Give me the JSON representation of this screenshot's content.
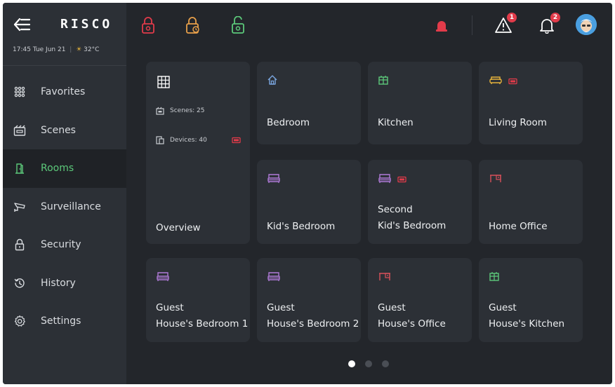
{
  "app": {
    "logo": "RISCO"
  },
  "status": {
    "time": "17:45",
    "date": "Tue Jun 21",
    "temperature": "32°C"
  },
  "sidebar": {
    "items": [
      {
        "label": "Favorites",
        "icon": "grid-icon",
        "active": false
      },
      {
        "label": "Scenes",
        "icon": "scenes-icon",
        "active": false
      },
      {
        "label": "Rooms",
        "icon": "door-icon",
        "active": true
      },
      {
        "label": "Surveillance",
        "icon": "camera-icon",
        "active": false
      },
      {
        "label": "Security",
        "icon": "lock-icon",
        "active": false
      },
      {
        "label": "History",
        "icon": "history-icon",
        "active": false
      },
      {
        "label": "Settings",
        "icon": "gear-icon",
        "active": false
      }
    ]
  },
  "topbar": {
    "lock_icons": [
      "lock-red-icon",
      "lock-orange-icon",
      "lock-open-green-icon"
    ],
    "alerts_count": "1",
    "notifications_count": "2"
  },
  "overview": {
    "title": "Overview",
    "scenes": "Scenes: 25",
    "devices": "Devices: 40"
  },
  "rooms": [
    {
      "line1": "Bedroom",
      "line2": "",
      "icon": "house-icon"
    },
    {
      "line1": "Kitchen",
      "line2": "",
      "icon": "kitchen-icon"
    },
    {
      "line1": "Living Room",
      "line2": "",
      "icon": "sofa-icon"
    },
    {
      "line1": "Kid's Bedroom",
      "line2": "",
      "icon": "bed-icon"
    },
    {
      "line1": "Second",
      "line2": "Kid's Bedroom",
      "icon": "bed-icon"
    },
    {
      "line1": "Home Office",
      "line2": "",
      "icon": "desk-icon"
    },
    {
      "line1": "Guest",
      "line2": "House's Bedroom 1",
      "icon": "bed-icon"
    },
    {
      "line1": "Guest",
      "line2": "House's Bedroom 2",
      "icon": "bed-icon"
    },
    {
      "line1": "Guest",
      "line2": "House's Office",
      "icon": "desk-icon"
    },
    {
      "line1": "Guest",
      "line2": "House's Kitchen",
      "icon": "kitchen-icon"
    }
  ],
  "pagination": {
    "pages": 3,
    "current": 1
  },
  "colors": {
    "accent_green": "#5cc97a",
    "alert_red": "#e23b4a",
    "lock_orange": "#e8a04a",
    "bed_purple": "#b07ad8",
    "house_blue": "#7aa6e0",
    "desk_red": "#d8505a",
    "sofa_yellow": "#e6b33b"
  }
}
